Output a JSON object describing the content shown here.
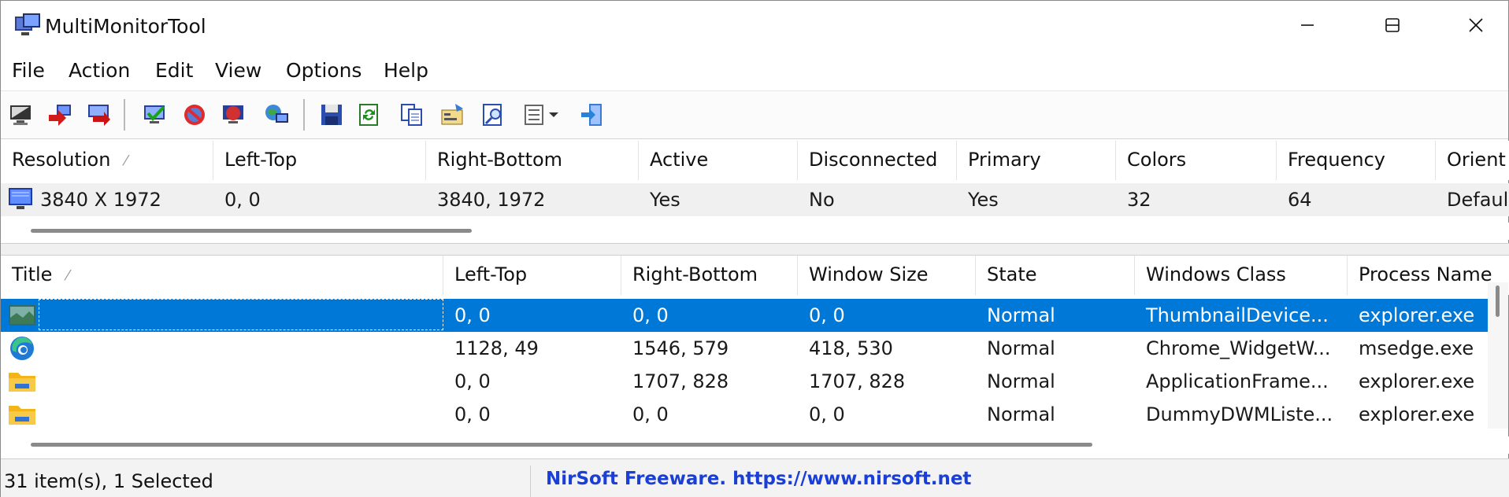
{
  "window": {
    "title": "MultiMonitorTool"
  },
  "menu": [
    "File",
    "Action",
    "Edit",
    "View",
    "Options",
    "Help"
  ],
  "toolbar": {
    "buttons": [
      "monitor-icon",
      "move-monitor-icon",
      "move-windows-icon",
      "enable-icon",
      "disable-icon",
      "switch-icon",
      "primary-icon",
      "save-icon",
      "refresh-icon",
      "copy-icon",
      "properties-icon",
      "find-icon",
      "view-icon",
      "exit-icon"
    ]
  },
  "monitors": {
    "columns": [
      "Resolution",
      "Left-Top",
      "Right-Bottom",
      "Active",
      "Disconnected",
      "Primary",
      "Colors",
      "Frequency",
      "Orient"
    ],
    "rows": [
      [
        "3840 X 1972",
        "0, 0",
        "3840, 1972",
        "Yes",
        "No",
        "Yes",
        "32",
        "64",
        "Defaul"
      ]
    ]
  },
  "windows": {
    "columns": [
      "Title",
      "Left-Top",
      "Right-Bottom",
      "Window Size",
      "State",
      "Windows Class",
      "Process Name"
    ],
    "rows": [
      {
        "icon": "thumbnail-icon",
        "cells": [
          "",
          "0, 0",
          "0, 0",
          "0, 0",
          "Normal",
          "ThumbnailDevice...",
          "explorer.exe"
        ],
        "selected": true
      },
      {
        "icon": "edge-icon",
        "cells": [
          "",
          "1128, 49",
          "1546, 579",
          "418, 530",
          "Normal",
          "Chrome_WidgetW...",
          "msedge.exe"
        ],
        "selected": false
      },
      {
        "icon": "folder-icon",
        "cells": [
          "",
          "0, 0",
          "1707, 828",
          "1707, 828",
          "Normal",
          "ApplicationFrame...",
          "explorer.exe"
        ],
        "selected": false
      },
      {
        "icon": "folder-icon",
        "cells": [
          "",
          "0, 0",
          "0, 0",
          "0, 0",
          "Normal",
          "DummyDWMListe...",
          "explorer.exe"
        ],
        "selected": false
      }
    ]
  },
  "status": {
    "items": "31 item(s), 1 Selected",
    "credit": "NirSoft Freeware. https://www.nirsoft.net"
  },
  "colors": {
    "selection": "#0078d7",
    "link": "#1a3fd6"
  }
}
